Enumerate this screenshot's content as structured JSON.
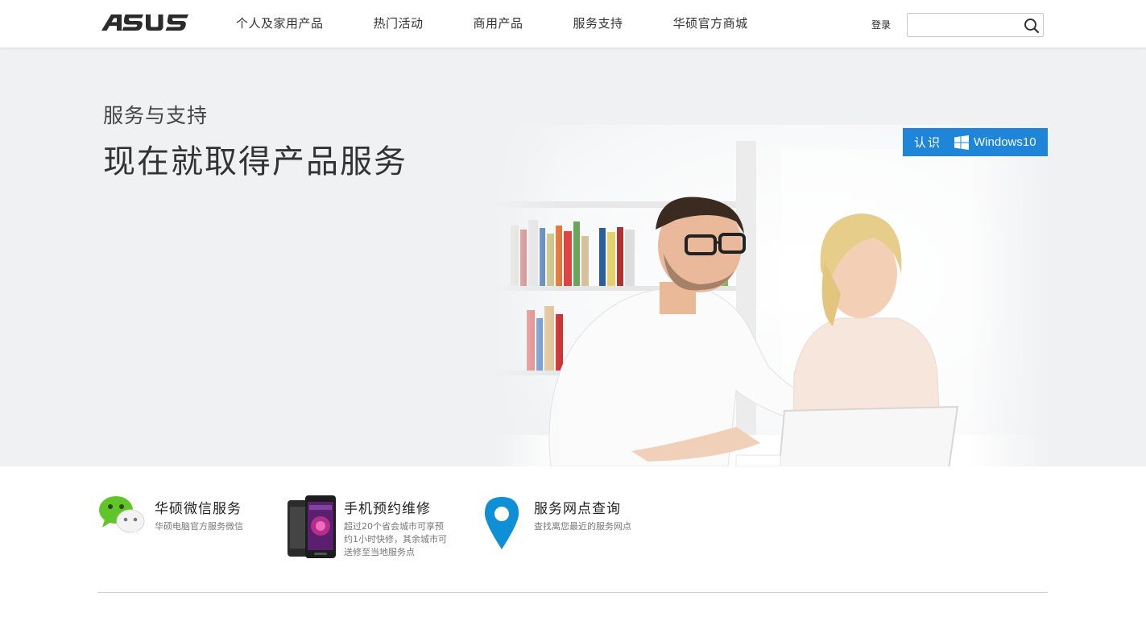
{
  "header": {
    "logo_text": "ASUS",
    "nav": [
      {
        "label": "个人及家用产品"
      },
      {
        "label": "热门活动"
      },
      {
        "label": "商用产品"
      },
      {
        "label": "服务支持"
      },
      {
        "label": "华硕官方商城"
      }
    ],
    "login_label": "登录",
    "search": {
      "value": "",
      "placeholder": ""
    }
  },
  "hero": {
    "subtitle": "服务与支持",
    "title": "现在就取得产品服务",
    "badge": {
      "label": "认识",
      "brand": "Windows10",
      "color": "#1f85d9"
    }
  },
  "services": [
    {
      "title": "华硕微信服务",
      "desc": [
        "华硕电脑官方服务微信"
      ],
      "icon": "wechat-icon"
    },
    {
      "title": "手机预约维修",
      "desc": [
        "超过20个省会城市可享预",
        "约1小时快修，其余城市可",
        "送修至当地服务点"
      ],
      "icon": "phone-image"
    },
    {
      "title": "服务网点查询",
      "desc": [
        "查找离您最近的服务网点"
      ],
      "icon": "map-pin-icon"
    }
  ],
  "colors": {
    "accent": "#1f85d9",
    "wechat_green": "#61c52a",
    "pin_blue": "#0e8fd6"
  }
}
